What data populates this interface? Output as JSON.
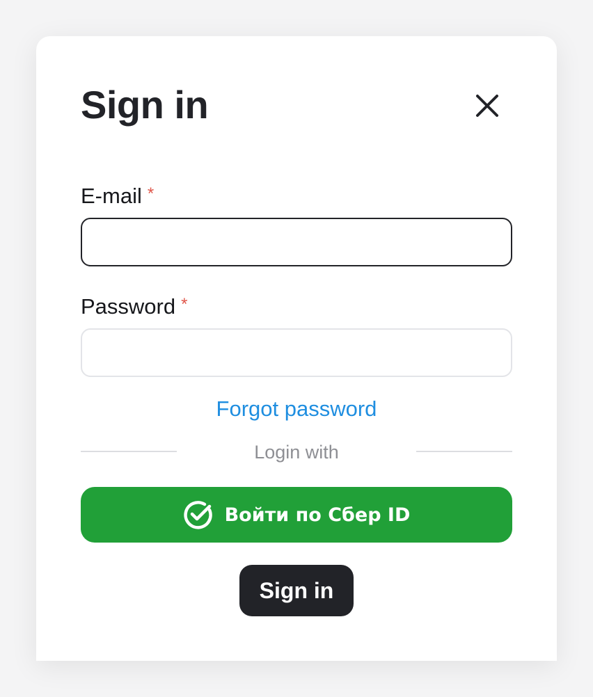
{
  "dialog": {
    "title": "Sign in",
    "close_icon": "close-icon"
  },
  "form": {
    "email": {
      "label": "E-mail",
      "required_mark": "*",
      "value": "",
      "placeholder": ""
    },
    "password": {
      "label": "Password",
      "required_mark": "*",
      "value": "",
      "placeholder": ""
    },
    "forgot_password": "Forgot password",
    "login_with": "Login with",
    "sber_button": {
      "label": "Войти по Сбер ID",
      "icon": "sber-check-icon"
    },
    "submit_label": "Sign in"
  },
  "colors": {
    "accent_green": "#21a038",
    "link_blue": "#1f8ee0",
    "required_red": "#e0574b",
    "dark": "#222328"
  }
}
